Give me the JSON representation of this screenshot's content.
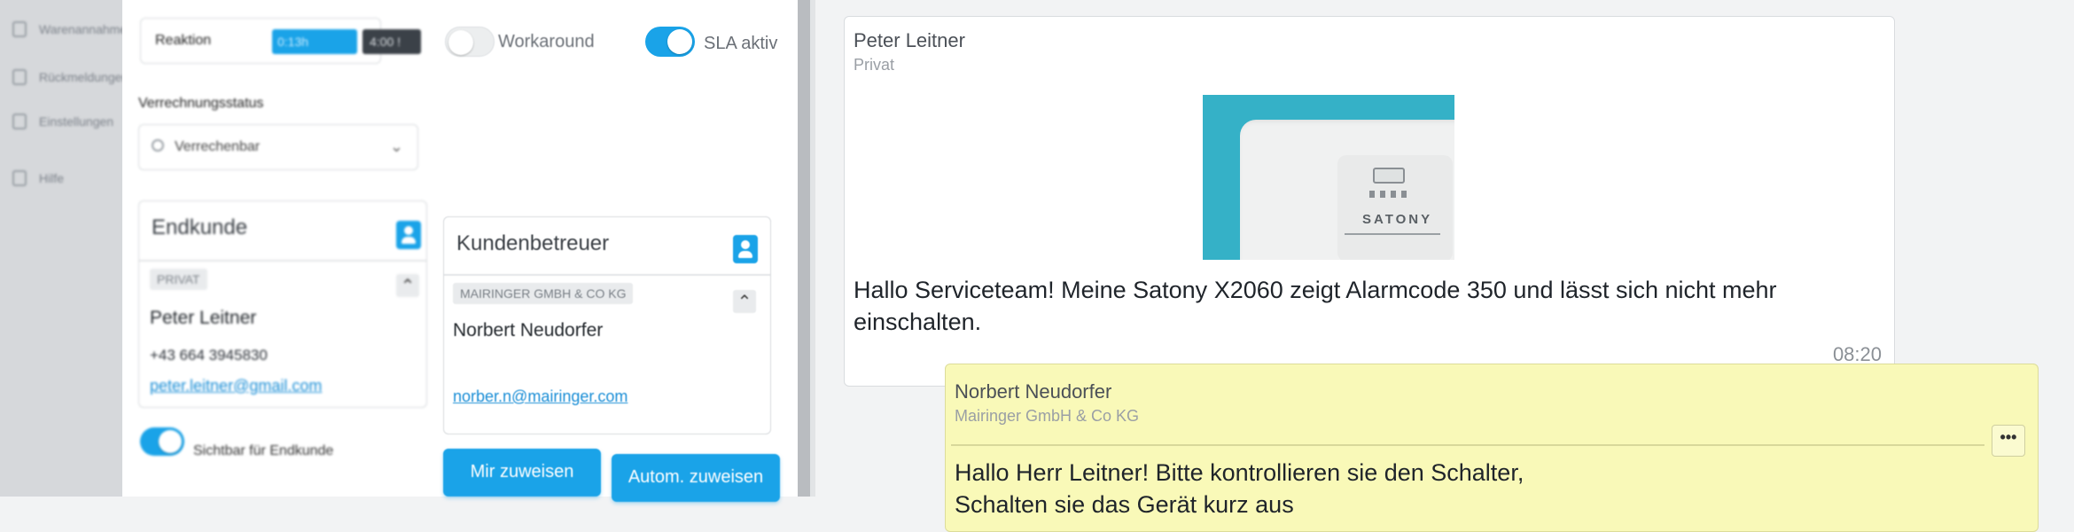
{
  "nav": {
    "items": [
      {
        "label": "Warenannahme",
        "icon": "box-icon"
      },
      {
        "label": "Rückmeldungen",
        "icon": "box-icon"
      },
      {
        "label": "Einstellungen",
        "icon": "gear-icon"
      },
      {
        "label": "Hilfe",
        "icon": "help-icon"
      }
    ]
  },
  "form": {
    "reaction": {
      "label": "Reaktion",
      "value1": "0:13h",
      "value2": "4:00 !"
    },
    "workaround": {
      "label": "Workaround",
      "on": false
    },
    "sla": {
      "label": "SLA aktiv",
      "on": true
    },
    "billing": {
      "label": "Verrechnungsstatus",
      "value": "Verrechenbar"
    },
    "endcustomer": {
      "title": "Endkunde",
      "tag": "PRIVAT",
      "name": "Peter Leitner",
      "phone": "+43 664 3945830",
      "email": "peter.leitner@gmail.com"
    },
    "account_manager": {
      "title": "Kundenbetreuer",
      "tag": "MAIRINGER GMBH & CO KG",
      "name": "Norbert Neudorfer",
      "email": "norber.n@mairinger.com"
    },
    "visible_toggle": {
      "label": "Sichtbar für Endkunde",
      "on": true
    },
    "buttons": {
      "assign_me": "Mir zuweisen",
      "auto_assign": "Autom. zuweisen"
    }
  },
  "chat": {
    "messages": [
      {
        "sender": "Peter Leitner",
        "sender_sub": "Privat",
        "image_brand": "SATONY",
        "text_line1": "Hallo Serviceteam! Meine Satony X2060 zeigt Alarmcode 350 und lässt sich nicht mehr",
        "text_line2": "einschalten.",
        "time": "08:20"
      },
      {
        "sender": "Norbert Neudorfer",
        "sender_sub": "Mairinger GmbH & Co KG",
        "menu": "•••",
        "text_line1": "Hallo Herr Leitner! Bitte kontrollieren sie den Schalter,",
        "text_line2": "Schalten sie das Gerät kurz aus"
      }
    ]
  },
  "colors": {
    "accent": "#1aa3e8",
    "own_message_bg": "#f9f9b8"
  }
}
